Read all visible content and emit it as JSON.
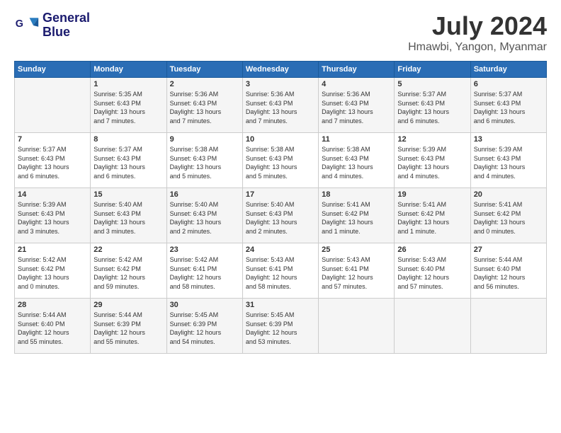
{
  "header": {
    "logo_line1": "General",
    "logo_line2": "Blue",
    "month": "July 2024",
    "location": "Hmawbi, Yangon, Myanmar"
  },
  "days_of_week": [
    "Sunday",
    "Monday",
    "Tuesday",
    "Wednesday",
    "Thursday",
    "Friday",
    "Saturday"
  ],
  "weeks": [
    [
      {
        "day": "",
        "info": ""
      },
      {
        "day": "1",
        "info": "Sunrise: 5:35 AM\nSunset: 6:43 PM\nDaylight: 13 hours\nand 7 minutes."
      },
      {
        "day": "2",
        "info": "Sunrise: 5:36 AM\nSunset: 6:43 PM\nDaylight: 13 hours\nand 7 minutes."
      },
      {
        "day": "3",
        "info": "Sunrise: 5:36 AM\nSunset: 6:43 PM\nDaylight: 13 hours\nand 7 minutes."
      },
      {
        "day": "4",
        "info": "Sunrise: 5:36 AM\nSunset: 6:43 PM\nDaylight: 13 hours\nand 7 minutes."
      },
      {
        "day": "5",
        "info": "Sunrise: 5:37 AM\nSunset: 6:43 PM\nDaylight: 13 hours\nand 6 minutes."
      },
      {
        "day": "6",
        "info": "Sunrise: 5:37 AM\nSunset: 6:43 PM\nDaylight: 13 hours\nand 6 minutes."
      }
    ],
    [
      {
        "day": "7",
        "info": "Sunrise: 5:37 AM\nSunset: 6:43 PM\nDaylight: 13 hours\nand 6 minutes."
      },
      {
        "day": "8",
        "info": "Sunrise: 5:37 AM\nSunset: 6:43 PM\nDaylight: 13 hours\nand 6 minutes."
      },
      {
        "day": "9",
        "info": "Sunrise: 5:38 AM\nSunset: 6:43 PM\nDaylight: 13 hours\nand 5 minutes."
      },
      {
        "day": "10",
        "info": "Sunrise: 5:38 AM\nSunset: 6:43 PM\nDaylight: 13 hours\nand 5 minutes."
      },
      {
        "day": "11",
        "info": "Sunrise: 5:38 AM\nSunset: 6:43 PM\nDaylight: 13 hours\nand 4 minutes."
      },
      {
        "day": "12",
        "info": "Sunrise: 5:39 AM\nSunset: 6:43 PM\nDaylight: 13 hours\nand 4 minutes."
      },
      {
        "day": "13",
        "info": "Sunrise: 5:39 AM\nSunset: 6:43 PM\nDaylight: 13 hours\nand 4 minutes."
      }
    ],
    [
      {
        "day": "14",
        "info": "Sunrise: 5:39 AM\nSunset: 6:43 PM\nDaylight: 13 hours\nand 3 minutes."
      },
      {
        "day": "15",
        "info": "Sunrise: 5:40 AM\nSunset: 6:43 PM\nDaylight: 13 hours\nand 3 minutes."
      },
      {
        "day": "16",
        "info": "Sunrise: 5:40 AM\nSunset: 6:43 PM\nDaylight: 13 hours\nand 2 minutes."
      },
      {
        "day": "17",
        "info": "Sunrise: 5:40 AM\nSunset: 6:43 PM\nDaylight: 13 hours\nand 2 minutes."
      },
      {
        "day": "18",
        "info": "Sunrise: 5:41 AM\nSunset: 6:42 PM\nDaylight: 13 hours\nand 1 minute."
      },
      {
        "day": "19",
        "info": "Sunrise: 5:41 AM\nSunset: 6:42 PM\nDaylight: 13 hours\nand 1 minute."
      },
      {
        "day": "20",
        "info": "Sunrise: 5:41 AM\nSunset: 6:42 PM\nDaylight: 13 hours\nand 0 minutes."
      }
    ],
    [
      {
        "day": "21",
        "info": "Sunrise: 5:42 AM\nSunset: 6:42 PM\nDaylight: 13 hours\nand 0 minutes."
      },
      {
        "day": "22",
        "info": "Sunrise: 5:42 AM\nSunset: 6:42 PM\nDaylight: 12 hours\nand 59 minutes."
      },
      {
        "day": "23",
        "info": "Sunrise: 5:42 AM\nSunset: 6:41 PM\nDaylight: 12 hours\nand 58 minutes."
      },
      {
        "day": "24",
        "info": "Sunrise: 5:43 AM\nSunset: 6:41 PM\nDaylight: 12 hours\nand 58 minutes."
      },
      {
        "day": "25",
        "info": "Sunrise: 5:43 AM\nSunset: 6:41 PM\nDaylight: 12 hours\nand 57 minutes."
      },
      {
        "day": "26",
        "info": "Sunrise: 5:43 AM\nSunset: 6:40 PM\nDaylight: 12 hours\nand 57 minutes."
      },
      {
        "day": "27",
        "info": "Sunrise: 5:44 AM\nSunset: 6:40 PM\nDaylight: 12 hours\nand 56 minutes."
      }
    ],
    [
      {
        "day": "28",
        "info": "Sunrise: 5:44 AM\nSunset: 6:40 PM\nDaylight: 12 hours\nand 55 minutes."
      },
      {
        "day": "29",
        "info": "Sunrise: 5:44 AM\nSunset: 6:39 PM\nDaylight: 12 hours\nand 55 minutes."
      },
      {
        "day": "30",
        "info": "Sunrise: 5:45 AM\nSunset: 6:39 PM\nDaylight: 12 hours\nand 54 minutes."
      },
      {
        "day": "31",
        "info": "Sunrise: 5:45 AM\nSunset: 6:39 PM\nDaylight: 12 hours\nand 53 minutes."
      },
      {
        "day": "",
        "info": ""
      },
      {
        "day": "",
        "info": ""
      },
      {
        "day": "",
        "info": ""
      }
    ]
  ]
}
